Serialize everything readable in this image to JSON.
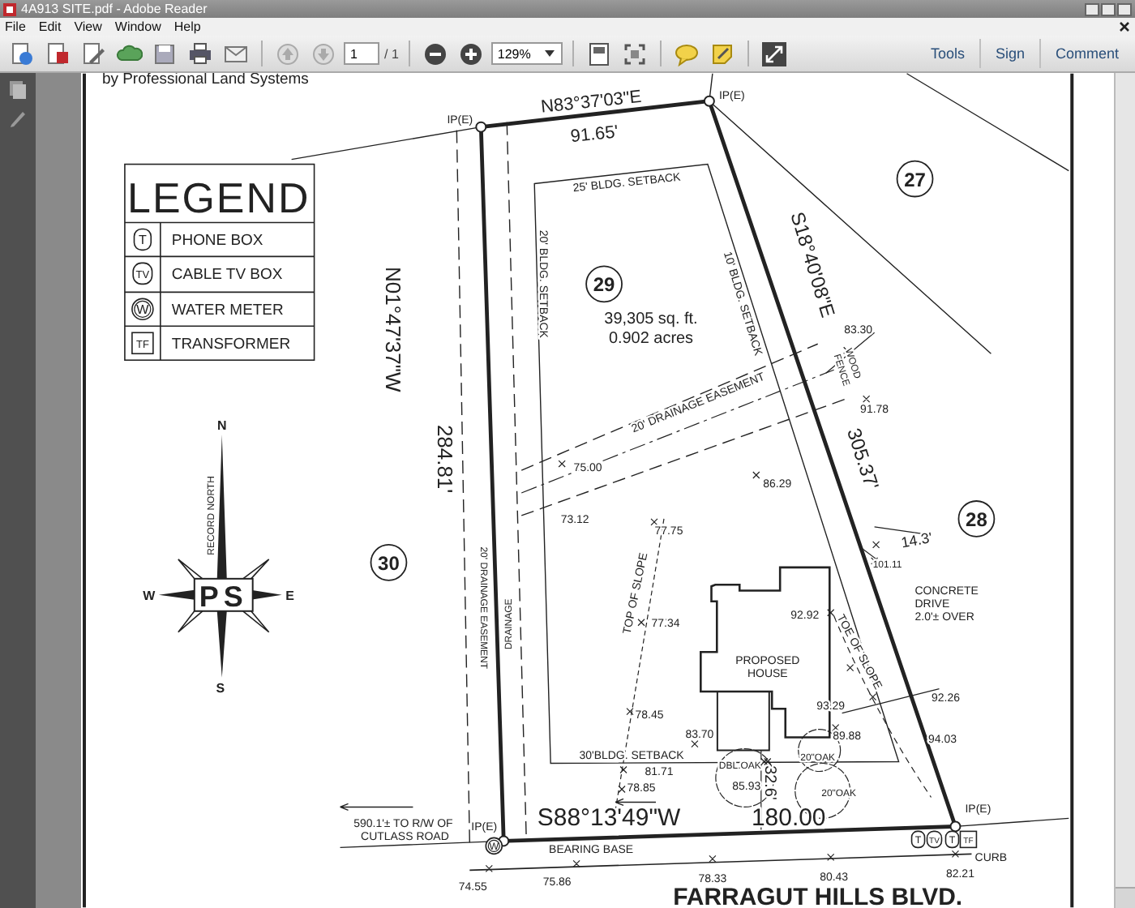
{
  "window": {
    "title": "4A913 SITE.pdf - Adobe Reader"
  },
  "menu": [
    "File",
    "Edit",
    "View",
    "Window",
    "Help"
  ],
  "toolbar": {
    "page": "1",
    "page_total": "/ 1",
    "zoom": "129%",
    "panels": [
      "Tools",
      "Sign",
      "Comment"
    ]
  },
  "document": {
    "credit": "by Professional Land Systems",
    "legend": {
      "title": "LEGEND",
      "items": [
        {
          "kind": "phone",
          "symbol": "T",
          "label": "PHONE BOX"
        },
        {
          "kind": "cable",
          "symbol": "TV",
          "label": "CABLE TV BOX"
        },
        {
          "kind": "water",
          "symbol": "W",
          "label": "WATER METER"
        },
        {
          "kind": "transformer",
          "symbol": "TF",
          "label": "TRANSFORMER"
        }
      ]
    },
    "lots": [
      "29",
      "27",
      "28",
      "30"
    ],
    "labels": [
      "IP(E)",
      "N83°37'03\"E",
      "91.65'",
      "IP(E)",
      "25' BLDG. SETBACK",
      "20' BLDG. SETBACK",
      "10' BLDG. SETBACK",
      "39,305 sq. ft.",
      "0.902 acres",
      "S18°40'08\"E",
      "83.30",
      "WOOD",
      "FENCE",
      "91.78",
      "305.37'",
      "20' DRAINAGE EASEMENT",
      "75.00",
      "86.29",
      "73.12",
      "77.75",
      "14.3'",
      "101.11",
      "N01°47'37\"W",
      "284.81'",
      "20' DRAINAGE EASEMENT",
      "DRAINAGE",
      "TOP OF SLOPE",
      "77.34",
      "92.92",
      "PROPOSED",
      "HOUSE",
      "CONCRETE",
      "DRIVE",
      "2.0'± OVER",
      "TOE OF SLOPE",
      "93.29",
      "92.26",
      "94.03",
      "78.45",
      "83.70",
      "89.88",
      "30'BLDG. SETBACK",
      "DBL.OAK",
      "20\"OAK",
      "81.71",
      "85.93",
      "20\"OAK",
      "78.85",
      "32.6'",
      "S88°13'49\"W",
      "180.00",
      "IP(E)",
      "590.1'± TO R/W OF",
      "CUTLASS ROAD",
      "IP(E)",
      "BEARING BASE",
      "CURB",
      "74.55",
      "75.86",
      "78.33",
      "80.43",
      "82.21",
      "FARRAGUT HILLS BLVD."
    ],
    "compass": {
      "caption": "RECORD NORTH",
      "logo": "PS",
      "points": [
        "N",
        "E",
        "S",
        "W"
      ]
    },
    "utility_marks": [
      {
        "kind": "water",
        "symbol": "W"
      },
      {
        "kind": "phone",
        "symbol": "T"
      },
      {
        "kind": "cable",
        "symbol": "TV"
      },
      {
        "kind": "phone",
        "symbol": "T"
      },
      {
        "kind": "transformer",
        "symbol": "TF"
      }
    ]
  }
}
